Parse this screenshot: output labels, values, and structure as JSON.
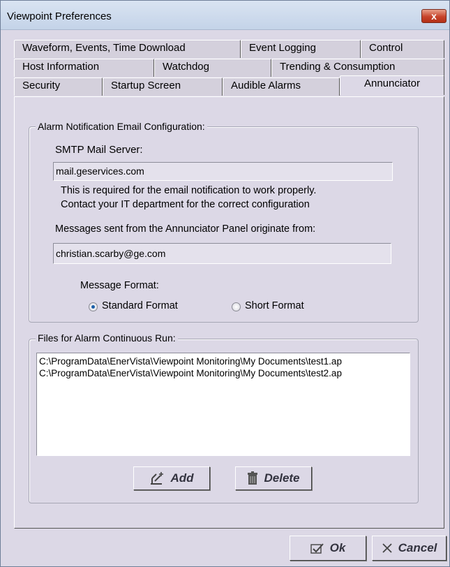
{
  "window": {
    "title": "Viewpoint Preferences",
    "close_label": "x"
  },
  "tabs": {
    "row1": [
      "Waveform, Events, Time Download",
      "Event Logging",
      "Control"
    ],
    "row2": [
      "Host Information",
      "Watchdog",
      "Trending & Consumption"
    ],
    "row3": [
      "Security",
      "Startup Screen",
      "Audible Alarms",
      "Annunciator"
    ],
    "active": "Annunciator"
  },
  "email_group": {
    "legend": "Alarm Notification Email Configuration:",
    "smtp_label": "SMTP Mail Server:",
    "smtp_value": "mail.geservices.com",
    "note_line1": "This is required for the email notification to work properly.",
    "note_line2": "Contact your IT department for the correct configuration",
    "from_label": "Messages sent from the Annunciator Panel originate from:",
    "from_value": "christian.scarby@ge.com",
    "format_label": "Message Format:",
    "format_options": [
      "Standard Format",
      "Short Format"
    ],
    "format_selected": "Standard Format"
  },
  "files_group": {
    "legend": "Files for Alarm Continuous Run:",
    "files": [
      "C:\\ProgramData\\EnerVista\\Viewpoint Monitoring\\My Documents\\test1.ap",
      "C:\\ProgramData\\EnerVista\\Viewpoint Monitoring\\My Documents\\test2.ap"
    ],
    "add_label": "Add",
    "delete_label": "Delete"
  },
  "footer": {
    "ok_label": "Ok",
    "cancel_label": "Cancel"
  },
  "colors": {
    "dialog_bg": "#dcd8e6",
    "titlebar": "#c4d3e8",
    "close_button": "#c7432b",
    "radio_dot": "#1a5ea8"
  },
  "icons": [
    "close-icon",
    "add-icon",
    "trash-icon",
    "check-icon",
    "x-icon"
  ]
}
